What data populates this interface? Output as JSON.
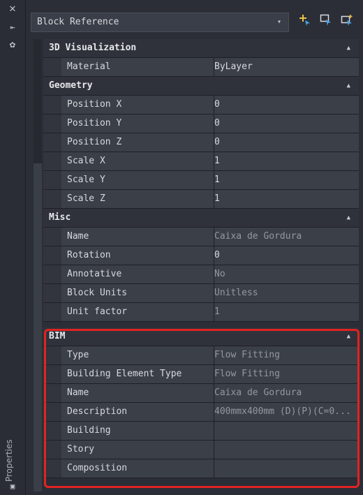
{
  "sidebar": {
    "label": "Properties",
    "close_glyph": "✕",
    "pin_glyph": "⇤",
    "settings_glyph": "✿"
  },
  "dropdown": {
    "value": "Block Reference",
    "caret": "▾"
  },
  "toolbar": {
    "icons": [
      "select-add-icon",
      "quick-select-icon",
      "select-objects-icon"
    ],
    "icon_color": "#4aa3e8"
  },
  "categories": [
    {
      "name": "3D Visualization",
      "rows": [
        {
          "name": "Material",
          "value": "ByLayer",
          "dim": false
        }
      ]
    },
    {
      "name": "Geometry",
      "rows": [
        {
          "name": "Position X",
          "value": "0",
          "dim": false
        },
        {
          "name": "Position Y",
          "value": "0",
          "dim": false
        },
        {
          "name": "Position Z",
          "value": "0",
          "dim": false
        },
        {
          "name": "Scale X",
          "value": "1",
          "dim": false
        },
        {
          "name": "Scale Y",
          "value": "1",
          "dim": false
        },
        {
          "name": "Scale Z",
          "value": "1",
          "dim": false
        }
      ]
    },
    {
      "name": "Misc",
      "rows": [
        {
          "name": "Name",
          "value": "Caixa de Gordura",
          "dim": true
        },
        {
          "name": "Rotation",
          "value": "0",
          "dim": false
        },
        {
          "name": "Annotative",
          "value": "No",
          "dim": true
        },
        {
          "name": "Block Units",
          "value": "Unitless",
          "dim": true
        },
        {
          "name": "Unit factor",
          "value": "1",
          "dim": true
        }
      ]
    },
    {
      "name": "BIM",
      "rows": [
        {
          "name": "Type",
          "value": "Flow Fitting",
          "dim": true
        },
        {
          "name": "Building Element Type",
          "value": "Flow Fitting",
          "dim": true
        },
        {
          "name": "Name",
          "value": "Caixa de Gordura",
          "dim": true
        },
        {
          "name": "Description",
          "value": "400mmx400mm (D)(P)(C=0...",
          "dim": true
        },
        {
          "name": "Building",
          "value": "",
          "dim": false
        },
        {
          "name": "Story",
          "value": "",
          "dim": false
        },
        {
          "name": "Composition",
          "value": "",
          "dim": false
        }
      ]
    }
  ],
  "collapse_glyph": "▲",
  "highlight_color": "#e12323"
}
